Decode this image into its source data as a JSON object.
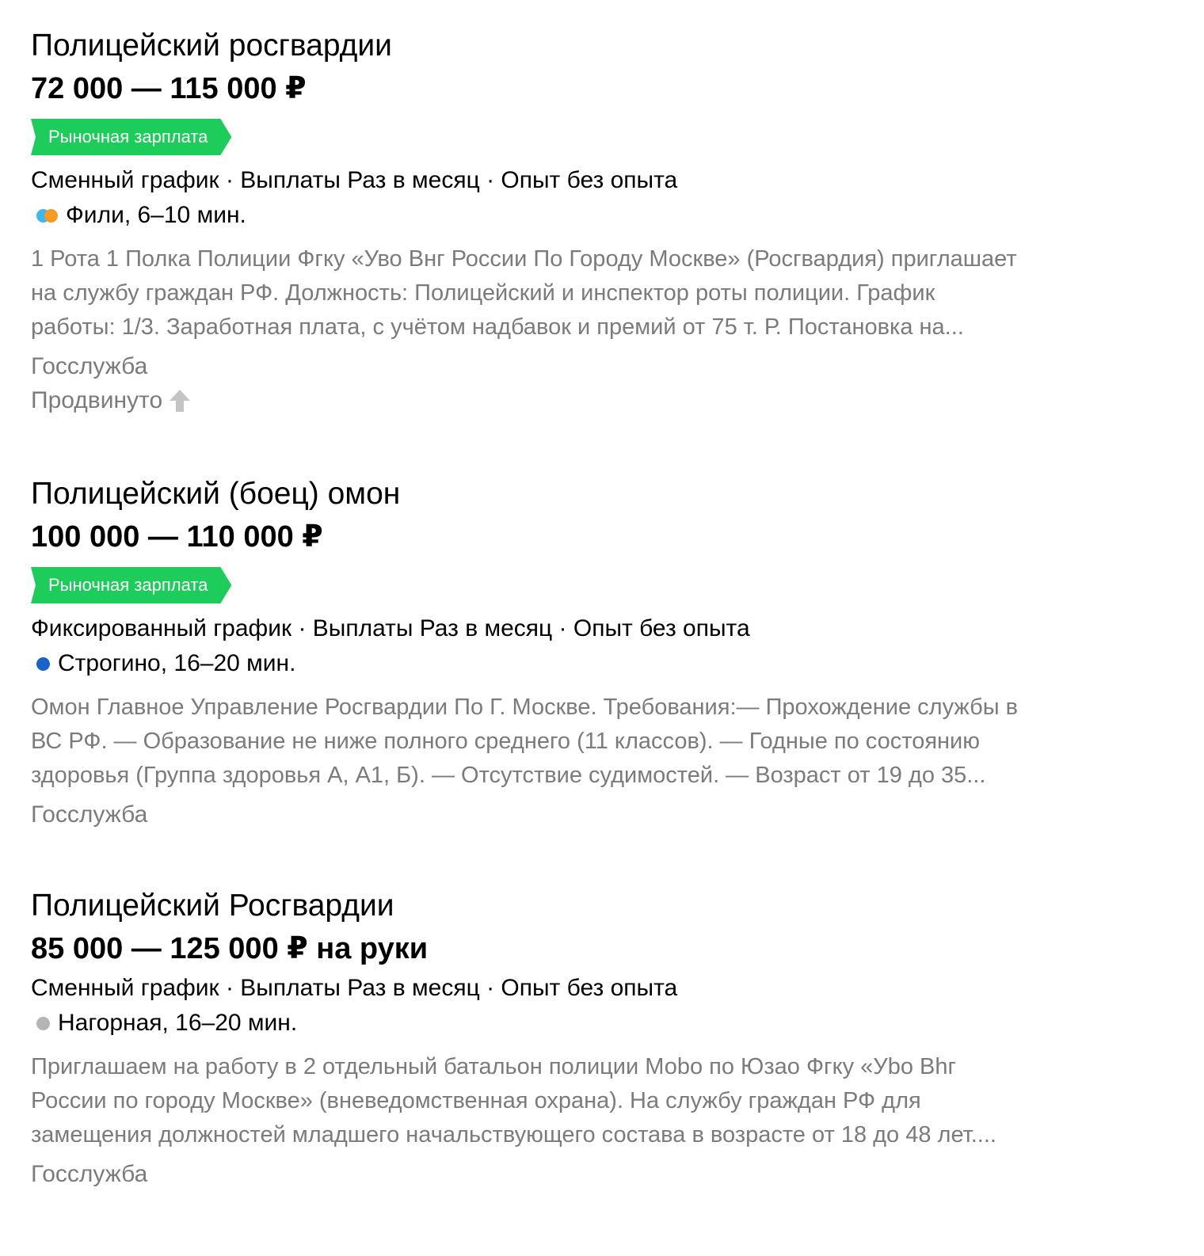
{
  "vacancies": [
    {
      "title": "Полицейский росгвардии",
      "salary": "72 000 — 115 000 ₽",
      "badge": "Рыночная зарплата",
      "meta": "Сменный график · Выплаты Раз в месяц · Опыт без опыта",
      "metro": {
        "station": "Фили, 6–10 мин.",
        "line_colors": [
          "#3fb6ef",
          "#f59a23"
        ]
      },
      "description_lines": [
        "1 Рота 1 Полка Полиции Фгку «Уво Внг России По Городу Москве» (Росгвардия) приглашает",
        "на службу граждан РФ. Должность: Полицейский и инспектор роты полиции. График",
        "работы: 1/3. Заработная плата, с учётом надбавок и премий от 75 т. Р. Постановка на..."
      ],
      "company": "Госслужба",
      "promoted": "Продвинуто",
      "promoted_icon": "arrow-up-icon"
    },
    {
      "title": "Полицейский (боец) омон",
      "salary": "100 000 — 110 000 ₽",
      "badge": "Рыночная зарплата",
      "meta": "Фиксированный график · Выплаты Раз в месяц · Опыт без опыта",
      "metro": {
        "station": "Строгино, 16–20 мин.",
        "line_colors": [
          "#1a62c6"
        ]
      },
      "description_lines": [
        "Омон Главное Управление Росгвардии По Г. Москве. Требования:— Прохождение службы в",
        "ВС РФ. — Образование не ниже полного среднего (11 классов). — Годные по состоянию",
        "здоровья (Группа здоровья А, А1, Б). — Отсутствие судимостей. — Возраст от 19 до 35..."
      ],
      "company": "Госслужба"
    },
    {
      "title": "Полицейский Росгвардии",
      "salary": "85 000 — 125 000 ₽ на руки",
      "meta": "Сменный график · Выплаты Раз в месяц · Опыт без опыта",
      "metro": {
        "station": "Нагорная, 16–20 мин.",
        "line_colors": [
          "#b5b5b5"
        ]
      },
      "description_lines": [
        "Приглашаем на работу в 2 отдельный батальон полиции Моbо по Юзао Фгку «Уbо Вhг",
        "России по городу Москве» (вневедомственная охрана). На службу граждан РФ для",
        "замещения должностей младшего начальствующего состава в возрасте от 18 до 48 лет...."
      ],
      "company": "Госслужба"
    }
  ]
}
